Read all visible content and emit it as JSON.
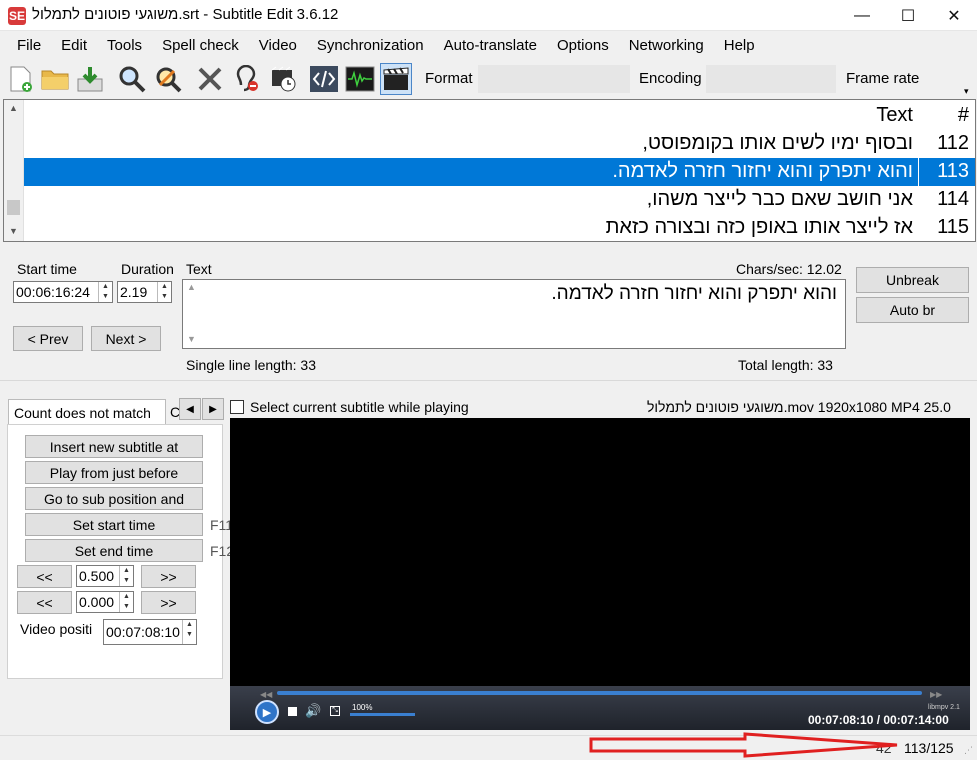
{
  "window": {
    "title": "משוגעי פוטונים לתמלול.srt - Subtitle Edit 3.6.12",
    "icon_text": "SE",
    "minimize": "—",
    "maximize": "☐",
    "close": "✕"
  },
  "menu": [
    "File",
    "Edit",
    "Tools",
    "Spell check",
    "Video",
    "Synchronization",
    "Auto-translate",
    "Options",
    "Networking",
    "Help"
  ],
  "toolbar": {
    "icons": [
      "new-file-icon",
      "open-folder-icon",
      "save-download-icon",
      "find-icon",
      "replace-icon",
      "fix-tools-icon",
      "spellcheck-ear-icon",
      "visual-sync-icon",
      "source-view-icon",
      "waveform-icon",
      "video-clapper-icon"
    ],
    "format_label": "Format",
    "format_value": "",
    "encoding_label": "Encoding",
    "encoding_value": "",
    "frame_rate_label": "Frame rate"
  },
  "grid": {
    "header_text": "Text",
    "header_num": "#",
    "rows": [
      {
        "num": "112",
        "text": "ובסוף ימיו לשים אותו בקומפוסט,"
      },
      {
        "num": "113",
        "text": "והוא יתפרק והוא יחזור חזרה לאדמה."
      },
      {
        "num": "114",
        "text": "אני חושב שאם כבר לייצר משהו,"
      },
      {
        "num": "115",
        "text": "אז לייצר אותו באופן כזה ובצורה כזאת"
      }
    ],
    "selected_index": 1
  },
  "editor": {
    "start_time_label": "Start time",
    "duration_label": "Duration",
    "text_label": "Text",
    "chars_sec": "Chars/sec: 12.02",
    "start_time": "00:06:16:24",
    "duration": "2.19",
    "text": "והוא יתפרק והוא יחזור חזרה לאדמה.",
    "prev": "< Prev",
    "next": "Next >",
    "single_line_length": "Single line length: 33",
    "total_length": "Total length: 33",
    "unbreak": "Unbreak",
    "auto_br": "Auto br"
  },
  "panel": {
    "tab_label": "Count does not match",
    "tab_next_partial": "C",
    "buttons": {
      "insert": "Insert new subtitle at",
      "play_before": "Play from just before",
      "go_to_sub": "Go to sub position and",
      "set_start": "Set start time",
      "set_end": "Set end time"
    },
    "fkey_start": "F11",
    "fkey_end": "F12",
    "back": "<<",
    "forward": ">>",
    "step1": "0.500",
    "step2": "0.000",
    "video_position_label": "Video positi",
    "video_position": "00:07:08:10"
  },
  "video": {
    "select_current_label": "Select current subtitle while playing",
    "file_info": "משוגעי פוטונים לתמלול.mov 1920x1080 MP4 25.0",
    "volume": "100%",
    "engine": "libmpv 2.1",
    "time": "00:07:08:10 / 00:07:14:00"
  },
  "status": {
    "left_num": "42",
    "position": "113/125"
  }
}
